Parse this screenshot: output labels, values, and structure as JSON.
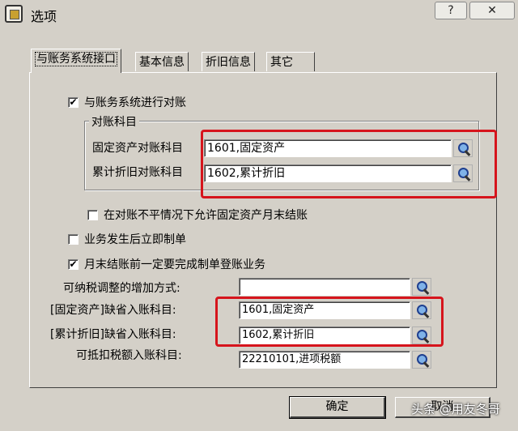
{
  "window": {
    "title": "选项",
    "help_label": "?",
    "close_label": "✕"
  },
  "tabs": [
    {
      "label": "与账务系统接口",
      "active": true
    },
    {
      "label": "基本信息",
      "active": false
    },
    {
      "label": "折旧信息",
      "active": false
    },
    {
      "label": "其它",
      "active": false
    }
  ],
  "reconcile": {
    "checkbox_label": "与账务系统进行对账",
    "checked": true,
    "group_title": "对账科目",
    "fixed_asset_label": "固定资产对账科目",
    "fixed_asset_value": "1601,固定资产",
    "depreciation_label": "累计折旧对账科目",
    "depreciation_value": "1602,累计折旧"
  },
  "options": {
    "allow_close_label": "在对账不平情况下允许固定资产月末结账",
    "allow_close_checked": false,
    "immediate_voucher_label": "业务发生后立即制单",
    "immediate_voucher_checked": false,
    "month_end_label": "月末结账前一定要完成制单登账业务",
    "month_end_checked": true
  },
  "accounts": {
    "tax_adjust_label": "可纳税调整的增加方式:",
    "tax_adjust_value": "",
    "fixed_default_label": "[固定资产]缺省入账科目:",
    "fixed_default_value": "1601,固定资产",
    "depr_default_label": "[累计折旧]缺省入账科目:",
    "depr_default_value": "1602,累计折旧",
    "deductible_tax_label": "可抵扣税额入账科目:",
    "deductible_tax_value": "22210101,进项税额"
  },
  "buttons": {
    "ok_label": "确定",
    "cancel_label": "取消"
  },
  "watermark": "头条 @用友冬哥",
  "colors": {
    "highlight_box": "#d6141c",
    "dialog_bg": "#d4d0c8"
  }
}
